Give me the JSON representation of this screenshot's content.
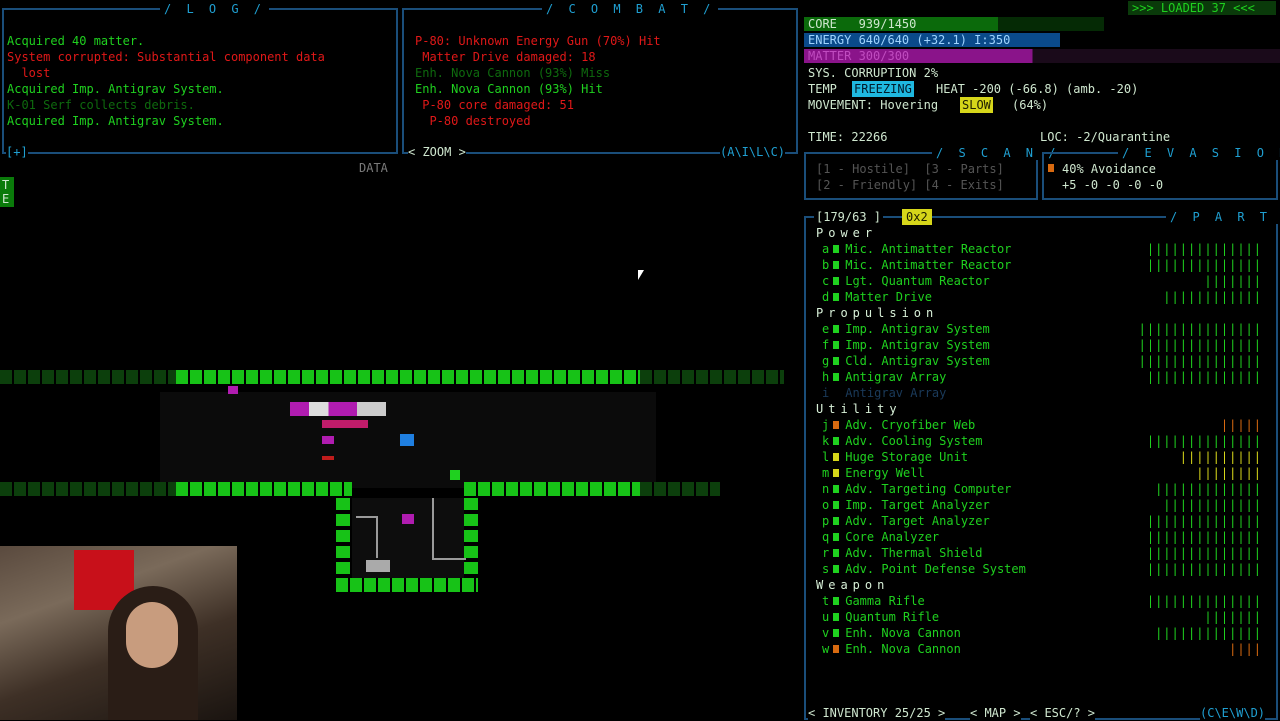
{
  "log": {
    "title": "/ L O G /",
    "lines": [
      {
        "text": "Acquired 40 matter.",
        "color": "g"
      },
      {
        "text": "System corrupted: Substantial component data",
        "color": "r"
      },
      {
        "text": "  lost",
        "color": "r"
      },
      {
        "text": "Acquired Imp. Antigrav System.",
        "color": "g"
      },
      {
        "text": "K-01 Serf collects debris.",
        "color": "dg"
      },
      {
        "text": "Acquired Imp. Antigrav System.",
        "color": "g"
      }
    ],
    "footer": "[+]"
  },
  "combat": {
    "title": "/ C O M B A T /",
    "lines": [
      {
        "text": "P-80: Unknown Energy Gun (70%) Hit",
        "color": "r"
      },
      {
        "text": " Matter Drive damaged: 18",
        "color": "r"
      },
      {
        "text": "Enh. Nova Cannon (93%) Miss",
        "color": "dg"
      },
      {
        "text": "Enh. Nova Cannon (93%) Hit",
        "color": "g"
      },
      {
        "text": " P-80 core damaged: 51",
        "color": "r"
      },
      {
        "text": "  P-80 destroyed",
        "color": "r"
      }
    ],
    "zoom": "< ZOOM >",
    "footer": "(A\\I\\L\\C)"
  },
  "data_label": "DATA",
  "status": {
    "loaded": ">>> LOADED 37 <<<",
    "core": "CORE   939/1450",
    "core_frac": 0.648,
    "energy": "ENERGY 640/640 (+32.1) I:350",
    "energy_frac": 1.0,
    "matter": "MATTER 300/300",
    "matter_frac": 1.0,
    "sys_corruption": "SYS. CORRUPTION 2%",
    "temp_label": "TEMP",
    "temp_state": "FREEZING",
    "heat": "HEAT -200 (-66.8) (amb. -20)",
    "movement_label": "MOVEMENT: Hovering",
    "movement_state": "SLOW",
    "movement_pct": "(64%)",
    "time": "TIME: 22266",
    "loc": "LOC: -2/Quarantine"
  },
  "scan": {
    "title": "/ S C A N /",
    "row1": "[1 - Hostile]  [3 - Parts]",
    "row2": "[2 - Friendly] [4 - Exits]"
  },
  "evasion": {
    "title": "/ E V A S I O N /",
    "avoidance": "40% Avoidance",
    "mods": "+5 -0 -0 -0 -0"
  },
  "parts": {
    "title": "/ P A R T S /",
    "slots": "[179/63 ]",
    "mode": "0x2",
    "categories": [
      {
        "name": "Power",
        "items": [
          {
            "key": "a",
            "name": "Mic. Antimatter Reactor",
            "bar": "||||||||||||||",
            "color": "#1fd11f",
            "state": "g"
          },
          {
            "key": "b",
            "name": "Mic. Antimatter Reactor",
            "bar": "||||||||||||||",
            "color": "#1fd11f",
            "state": "g"
          },
          {
            "key": "c",
            "name": "Lgt. Quantum Reactor",
            "bar": "|||||||",
            "color": "#1fd11f",
            "state": "g"
          },
          {
            "key": "d",
            "name": "Matter Drive",
            "bar": "||||||||||||",
            "color": "#1fd11f",
            "state": "g"
          }
        ]
      },
      {
        "name": "Propulsion",
        "items": [
          {
            "key": "e",
            "name": "Imp. Antigrav System",
            "bar": "|||||||||||||||",
            "color": "#1fd11f",
            "state": "g"
          },
          {
            "key": "f",
            "name": "Imp. Antigrav System",
            "bar": "|||||||||||||||",
            "color": "#1fd11f",
            "state": "g"
          },
          {
            "key": "g",
            "name": "Cld. Antigrav System",
            "bar": "|||||||||||||||",
            "color": "#1fd11f",
            "state": "g"
          },
          {
            "key": "h",
            "name": "Antigrav Array",
            "bar": "||||||||||||||",
            "color": "#1fd11f",
            "state": "g"
          },
          {
            "key": "i",
            "name": "Antigrav Array",
            "bar": "",
            "color": "#1a3a5a",
            "state": "dblue"
          }
        ]
      },
      {
        "name": "Utility",
        "items": [
          {
            "key": "j",
            "name": "Adv. Cryofiber Web",
            "bar": "|||||",
            "color": "#d86a10",
            "state": "g"
          },
          {
            "key": "k",
            "name": "Adv. Cooling System",
            "bar": "||||||||||||||",
            "color": "#1fd11f",
            "state": "g"
          },
          {
            "key": "l",
            "name": "Huge Storage Unit",
            "bar": "||||||||||",
            "color": "#d6d61a",
            "state": "g"
          },
          {
            "key": "m",
            "name": "Energy Well",
            "bar": "||||||||",
            "color": "#d6d61a",
            "state": "g"
          },
          {
            "key": "n",
            "name": "Adv. Targeting Computer",
            "bar": "|||||||||||||",
            "color": "#1fd11f",
            "state": "g"
          },
          {
            "key": "o",
            "name": "Imp. Target Analyzer",
            "bar": "||||||||||||",
            "color": "#1fd11f",
            "state": "g"
          },
          {
            "key": "p",
            "name": "Adv. Target Analyzer",
            "bar": "||||||||||||||",
            "color": "#1fd11f",
            "state": "g"
          },
          {
            "key": "q",
            "name": "Core Analyzer",
            "bar": "||||||||||||||",
            "color": "#1fd11f",
            "state": "g"
          },
          {
            "key": "r",
            "name": "Adv. Thermal Shield",
            "bar": "||||||||||||||",
            "color": "#1fd11f",
            "state": "g"
          },
          {
            "key": "s",
            "name": "Adv. Point Defense System",
            "bar": "||||||||||||||",
            "color": "#1fd11f",
            "state": "g"
          }
        ]
      },
      {
        "name": "Weapon",
        "items": [
          {
            "key": "t",
            "name": "Gamma Rifle",
            "bar": "||||||||||||||",
            "color": "#1fd11f",
            "state": "g"
          },
          {
            "key": "u",
            "name": "Quantum Rifle",
            "bar": "|||||||",
            "color": "#1fd11f",
            "state": "g"
          },
          {
            "key": "v",
            "name": "Enh. Nova Cannon",
            "bar": "|||||||||||||",
            "color": "#1fd11f",
            "state": "g"
          },
          {
            "key": "w",
            "name": "Enh. Nova Cannon",
            "bar": "||||",
            "color": "#d86a10",
            "state": "g"
          }
        ]
      }
    ]
  },
  "bottom": {
    "inventory": "< INVENTORY 25/25 >",
    "map": "< MAP >",
    "esc": "< ESC/? >",
    "right": "(C\\E\\W\\D)"
  },
  "map_left_glyph_top": "T",
  "map_left_glyph_bottom": "E"
}
